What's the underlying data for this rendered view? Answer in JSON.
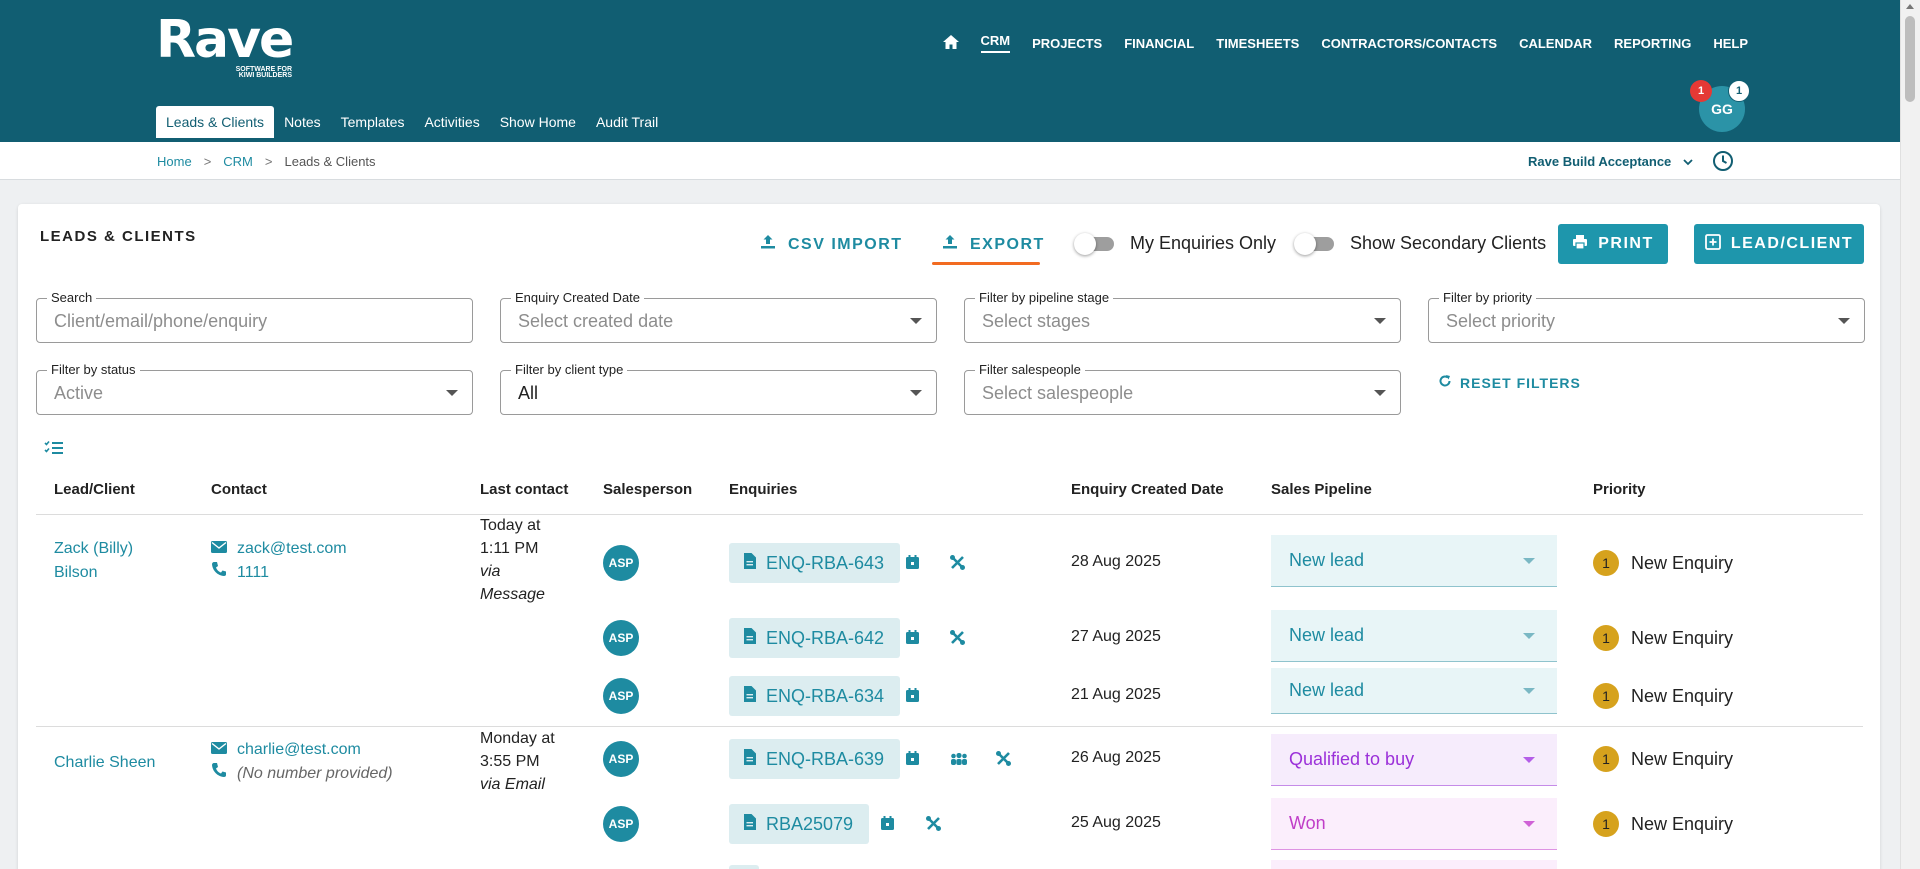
{
  "app": {
    "logo_text": "Rave",
    "logo_tagline_1": "SOFTWARE FOR",
    "logo_tagline_2": "KIWI BUILDERS"
  },
  "main_nav": {
    "items": [
      "CRM",
      "PROJECTS",
      "FINANCIAL",
      "TIMESHEETS",
      "CONTRACTORS/CONTACTS",
      "CALENDAR",
      "REPORTING",
      "HELP"
    ],
    "active": "CRM"
  },
  "sub_nav": {
    "items": [
      "Leads & Clients",
      "Notes",
      "Templates",
      "Activities",
      "Show Home",
      "Audit Trail"
    ],
    "active": "Leads & Clients"
  },
  "user": {
    "initials": "GG",
    "badge_red": "1",
    "badge_white": "1"
  },
  "breadcrumb": [
    "Home",
    "CRM",
    "Leads & Clients"
  ],
  "company": "Rave Build Acceptance",
  "page": {
    "title": "LEADS & CLIENTS",
    "csv_import": "CSV IMPORT",
    "export": "EXPORT",
    "toggle_my_enquiries": "My Enquiries Only",
    "toggle_secondary": "Show Secondary Clients",
    "print": "PRINT",
    "add_lead": "LEAD/CLIENT"
  },
  "filters": {
    "search": {
      "label": "Search",
      "placeholder": "Client/email/phone/enquiry"
    },
    "created_date": {
      "label": "Enquiry Created Date",
      "placeholder": "Select created date"
    },
    "pipeline_stage": {
      "label": "Filter by pipeline stage",
      "placeholder": "Select stages"
    },
    "priority": {
      "label": "Filter by priority",
      "placeholder": "Select priority"
    },
    "status": {
      "label": "Filter by status",
      "value": "Active"
    },
    "client_type": {
      "label": "Filter by client type",
      "value": "All"
    },
    "salespeople": {
      "label": "Filter salespeople",
      "placeholder": "Select salespeople"
    },
    "reset": "RESET FILTERS"
  },
  "table": {
    "headers": [
      "Lead/Client",
      "Contact",
      "Last contact",
      "Salesperson",
      "Enquiries",
      "Enquiry Created Date",
      "Sales Pipeline",
      "Priority"
    ],
    "clients": [
      {
        "name": "Zack (Billy) Bilson",
        "email": "zack@test.com",
        "phone": "1111",
        "last_contact_1": "Today at",
        "last_contact_2": "1:11 PM",
        "last_contact_via": "via Message",
        "enquiries": [
          {
            "salesperson": "ASP",
            "id": "ENQ-RBA-643",
            "date": "28 Aug 2025",
            "pipeline": "New lead",
            "priority_num": "1",
            "priority": "New Enquiry"
          },
          {
            "salesperson": "ASP",
            "id": "ENQ-RBA-642",
            "date": "27 Aug 2025",
            "pipeline": "New lead",
            "priority_num": "1",
            "priority": "New Enquiry"
          },
          {
            "salesperson": "ASP",
            "id": "ENQ-RBA-634",
            "date": "21 Aug 2025",
            "pipeline": "New lead",
            "priority_num": "1",
            "priority": "New Enquiry"
          }
        ]
      },
      {
        "name": "Charlie Sheen",
        "email": "charlie@test.com",
        "phone": "(No number provided)",
        "last_contact_1": "Monday at",
        "last_contact_2": "3:55 PM",
        "last_contact_via": "via Email",
        "enquiries": [
          {
            "salesperson": "ASP",
            "id": "ENQ-RBA-639",
            "date": "26 Aug 2025",
            "pipeline": "Qualified to buy",
            "priority_num": "1",
            "priority": "New Enquiry"
          },
          {
            "salesperson": "ASP",
            "id": "RBA25079",
            "date": "25 Aug 2025",
            "pipeline": "Won",
            "priority_num": "1",
            "priority": "New Enquiry"
          }
        ]
      }
    ]
  },
  "colors": {
    "header": "#115e72",
    "accent": "#1e96ac",
    "export_underline": "#f26b21",
    "pipeline_new_lead": "#1e8ba1",
    "pipeline_qualified": "#9b30d9",
    "pipeline_won": "#c03ec8",
    "priority_badge": "#d6a21d"
  }
}
